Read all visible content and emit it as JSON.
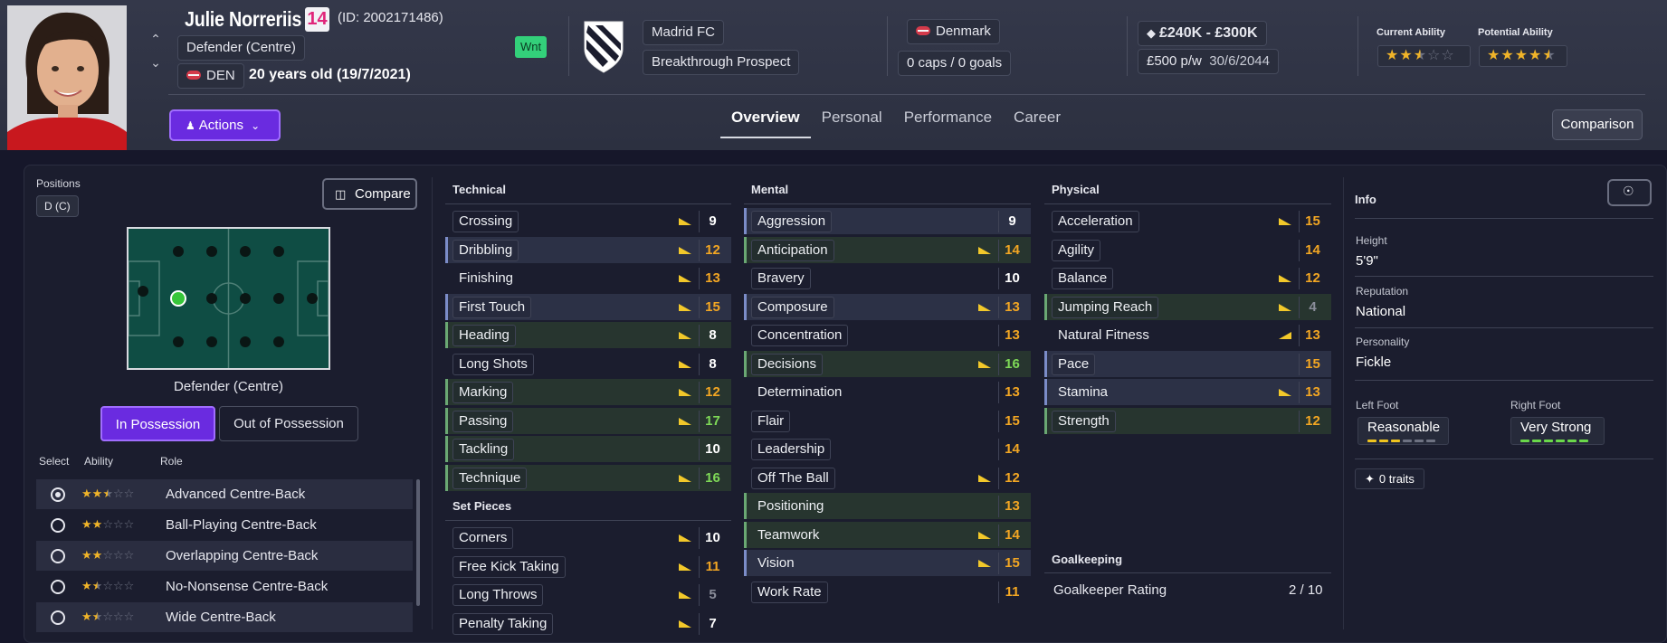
{
  "player": {
    "name": "Julie Norreriis",
    "number": "14",
    "id": "(ID: 2002171486)",
    "position": "Defender (Centre)",
    "nationality_code": "DEN",
    "age": "20 years old (19/7/2021)",
    "wnt_badge": "Wnt"
  },
  "club": {
    "name": "Madrid FC",
    "status": "Breakthrough Prospect"
  },
  "nation": {
    "name": "Denmark",
    "caps": "0 caps / 0 goals"
  },
  "contract": {
    "value": "£240K - £300K",
    "wage": "£500 p/w",
    "expiry": "30/6/2044"
  },
  "ability": {
    "current_label": "Current Ability",
    "potential_label": "Potential Ability",
    "current_stars": 2.5,
    "potential_stars": 4.5
  },
  "toolbar": {
    "actions_label": "Actions",
    "comparison_label": "Comparison",
    "tabs": [
      "Overview",
      "Personal",
      "Performance",
      "Career"
    ]
  },
  "left_panel": {
    "positions_label": "Positions",
    "position_code": "D (C)",
    "compare_label": "Compare",
    "pitch_position_label": "Defender (Centre)",
    "in_possession": "In Possession",
    "out_possession": "Out of Possession",
    "headers": {
      "select": "Select",
      "ability": "Ability",
      "role": "Role"
    },
    "roles": [
      {
        "name": "Advanced Centre-Back",
        "stars": 2.5,
        "selected": true
      },
      {
        "name": "Ball-Playing Centre-Back",
        "stars": 2,
        "selected": false
      },
      {
        "name": "Overlapping Centre-Back",
        "stars": 2,
        "selected": false
      },
      {
        "name": "No-Nonsense Centre-Back",
        "stars": 1.5,
        "selected": false
      },
      {
        "name": "Wide Centre-Back",
        "stars": 1.5,
        "selected": false
      }
    ]
  },
  "technical": {
    "title": "Technical",
    "attrs": [
      {
        "name": "Crossing",
        "value": "9",
        "trend": "down",
        "color": "white",
        "boxed": true,
        "hl": "none"
      },
      {
        "name": "Dribbling",
        "value": "12",
        "trend": "down",
        "color": "orange",
        "boxed": true,
        "hl": "blue"
      },
      {
        "name": "Finishing",
        "value": "13",
        "trend": "down",
        "color": "orange",
        "boxed": false,
        "hl": "none"
      },
      {
        "name": "First Touch",
        "value": "15",
        "trend": "down",
        "color": "orange",
        "boxed": true,
        "hl": "blue"
      },
      {
        "name": "Heading",
        "value": "8",
        "trend": "down",
        "color": "white",
        "boxed": true,
        "hl": "green"
      },
      {
        "name": "Long Shots",
        "value": "8",
        "trend": "down",
        "color": "white",
        "boxed": true,
        "hl": "none"
      },
      {
        "name": "Marking",
        "value": "12",
        "trend": "down",
        "color": "orange",
        "boxed": true,
        "hl": "green"
      },
      {
        "name": "Passing",
        "value": "17",
        "trend": "down",
        "color": "green",
        "boxed": true,
        "hl": "green"
      },
      {
        "name": "Tackling",
        "value": "10",
        "trend": "none",
        "color": "white",
        "boxed": true,
        "hl": "green"
      },
      {
        "name": "Technique",
        "value": "16",
        "trend": "down",
        "color": "green",
        "boxed": true,
        "hl": "green"
      }
    ]
  },
  "set_pieces": {
    "title": "Set Pieces",
    "attrs": [
      {
        "name": "Corners",
        "value": "10",
        "trend": "down",
        "color": "white",
        "boxed": true,
        "hl": "none"
      },
      {
        "name": "Free Kick Taking",
        "value": "11",
        "trend": "down",
        "color": "orange",
        "boxed": true,
        "hl": "none"
      },
      {
        "name": "Long Throws",
        "value": "5",
        "trend": "down",
        "color": "grey",
        "boxed": true,
        "hl": "none"
      },
      {
        "name": "Penalty Taking",
        "value": "7",
        "trend": "down",
        "color": "white",
        "boxed": true,
        "hl": "none"
      }
    ]
  },
  "mental": {
    "title": "Mental",
    "attrs": [
      {
        "name": "Aggression",
        "value": "9",
        "trend": "none",
        "color": "white",
        "boxed": true,
        "hl": "blue"
      },
      {
        "name": "Anticipation",
        "value": "14",
        "trend": "down",
        "color": "orange",
        "boxed": true,
        "hl": "green"
      },
      {
        "name": "Bravery",
        "value": "10",
        "trend": "none",
        "color": "white",
        "boxed": true,
        "hl": "none"
      },
      {
        "name": "Composure",
        "value": "13",
        "trend": "down",
        "color": "orange",
        "boxed": true,
        "hl": "blue"
      },
      {
        "name": "Concentration",
        "value": "13",
        "trend": "none",
        "color": "orange",
        "boxed": true,
        "hl": "none"
      },
      {
        "name": "Decisions",
        "value": "16",
        "trend": "down",
        "color": "green",
        "boxed": true,
        "hl": "green"
      },
      {
        "name": "Determination",
        "value": "13",
        "trend": "none",
        "color": "orange",
        "boxed": false,
        "hl": "none"
      },
      {
        "name": "Flair",
        "value": "15",
        "trend": "none",
        "color": "orange",
        "boxed": true,
        "hl": "none"
      },
      {
        "name": "Leadership",
        "value": "14",
        "trend": "none",
        "color": "orange",
        "boxed": true,
        "hl": "none"
      },
      {
        "name": "Off The Ball",
        "value": "12",
        "trend": "down",
        "color": "orange",
        "boxed": true,
        "hl": "none"
      },
      {
        "name": "Positioning",
        "value": "13",
        "trend": "none",
        "color": "orange",
        "boxed": false,
        "hl": "green"
      },
      {
        "name": "Teamwork",
        "value": "14",
        "trend": "down",
        "color": "orange",
        "boxed": false,
        "hl": "green"
      },
      {
        "name": "Vision",
        "value": "15",
        "trend": "down",
        "color": "orange",
        "boxed": false,
        "hl": "blue"
      },
      {
        "name": "Work Rate",
        "value": "11",
        "trend": "none",
        "color": "orange",
        "boxed": true,
        "hl": "none"
      }
    ]
  },
  "physical": {
    "title": "Physical",
    "attrs": [
      {
        "name": "Acceleration",
        "value": "15",
        "trend": "down",
        "color": "orange",
        "boxed": true,
        "hl": "none"
      },
      {
        "name": "Agility",
        "value": "14",
        "trend": "none",
        "color": "orange",
        "boxed": true,
        "hl": "none"
      },
      {
        "name": "Balance",
        "value": "12",
        "trend": "down",
        "color": "orange",
        "boxed": true,
        "hl": "none"
      },
      {
        "name": "Jumping Reach",
        "value": "4",
        "trend": "down",
        "color": "grey",
        "boxed": true,
        "hl": "green"
      },
      {
        "name": "Natural Fitness",
        "value": "13",
        "trend": "up",
        "color": "orange",
        "boxed": false,
        "hl": "none"
      },
      {
        "name": "Pace",
        "value": "15",
        "trend": "none",
        "color": "orange",
        "boxed": true,
        "hl": "blue"
      },
      {
        "name": "Stamina",
        "value": "13",
        "trend": "down",
        "color": "orange",
        "boxed": false,
        "hl": "blue"
      },
      {
        "name": "Strength",
        "value": "12",
        "trend": "none",
        "color": "orange",
        "boxed": true,
        "hl": "green"
      }
    ]
  },
  "goalkeeping": {
    "title": "Goalkeeping",
    "rating_label": "Goalkeeper Rating",
    "rating_value": "2 / 10"
  },
  "info": {
    "title": "Info",
    "height_label": "Height",
    "height": "5'9\"",
    "reputation_label": "Reputation",
    "reputation": "National",
    "personality_label": "Personality",
    "personality": "Fickle",
    "left_foot_label": "Left Foot",
    "left_foot": "Reasonable",
    "left_foot_level": 3,
    "right_foot_label": "Right Foot",
    "right_foot": "Very Strong",
    "right_foot_level": 6,
    "traits": "0 traits"
  },
  "colors": {
    "accent_purple": "#6a2be0",
    "value_orange": "#f2a623",
    "value_green": "#7ed957",
    "star": "#f0b429",
    "number_pink": "#e0257a"
  }
}
